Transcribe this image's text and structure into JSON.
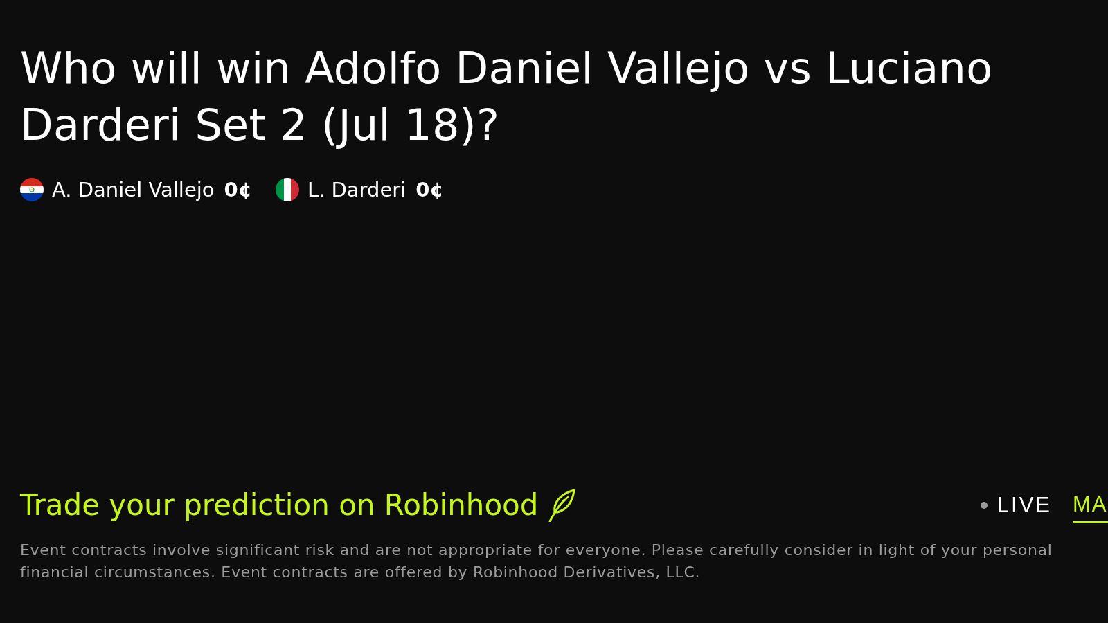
{
  "title": "Who will win Adolfo Daniel Vallejo vs Luciano Darderi Set 2 (Jul 18)?",
  "players": [
    {
      "kind": "paraguay",
      "name": "A. Daniel Vallejo",
      "price": "0¢"
    },
    {
      "kind": "italy",
      "name": "L. Darderi",
      "price": "0¢"
    }
  ],
  "promo": {
    "headline": "Trade your prediction on Robinhood"
  },
  "live_indicator": {
    "label": "LIVE"
  },
  "tabs": [
    {
      "label": "MA",
      "selected": true
    }
  ],
  "disclaimer": "Event contracts involve significant risk and are not appropriate for everyone. Please carefully consider in light of your personal financial circumstances. Event contracts are offered by Robinhood Derivatives, LLC."
}
